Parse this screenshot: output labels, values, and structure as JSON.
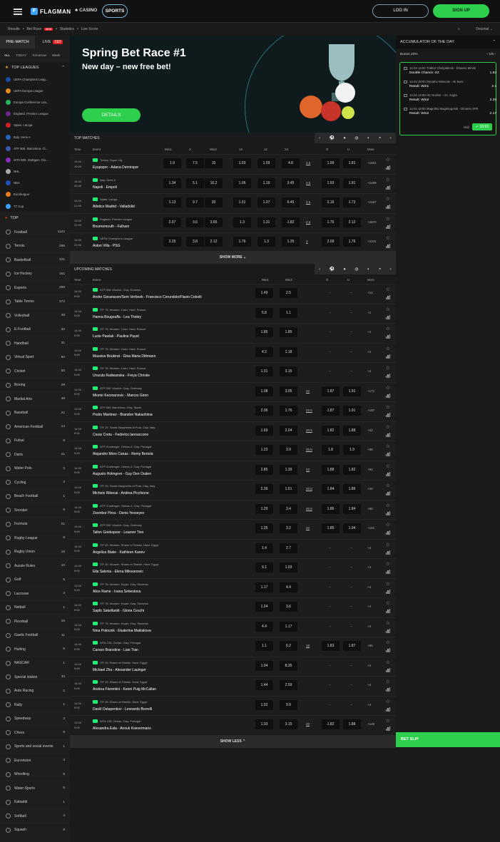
{
  "header": {
    "logo": "FLAGMAN",
    "casino": "CASINO",
    "sports": "SPORTS",
    "login": "LOG IN",
    "signup": "SIGN UP"
  },
  "breadcrumbs": [
    "Results",
    "Bet Race",
    "Statistics",
    "Live Score"
  ],
  "breadcrumb_new": "NEW",
  "odds_format": "Decimal",
  "sidebar": {
    "tab_prematch": "PRE-MATCH",
    "tab_live": "LIVE",
    "live_count": "192",
    "filters": [
      "ALL",
      "TODAY",
      "Tomorrow",
      "Week"
    ],
    "top_leagues_label": "TOP LEAGUES",
    "leagues": [
      "UEFA Champions Leag...",
      "UEFA Europa League",
      "Europa Conference Lea...",
      "England. Premier League",
      "Spain. LaLiga",
      "Italy. Serie A",
      "ATP 500. Barcelona. Cl...",
      "WTA 500. Stuttgart. Cla...",
      "NHL",
      "NBA",
      "Euroleague",
      "T7 Cup"
    ],
    "top_label": "TOP",
    "sports": [
      [
        "Football",
        "1122"
      ],
      [
        "Tennis",
        "296"
      ],
      [
        "Basketball",
        "101"
      ],
      [
        "Ice Hockey",
        "151"
      ],
      [
        "Esports",
        "269"
      ],
      [
        "Table Tennis",
        "272"
      ],
      [
        "Volleyball",
        "48"
      ],
      [
        "E-Football",
        "32"
      ],
      [
        "Handball",
        "31"
      ],
      [
        "Virtual Sport",
        "90"
      ],
      [
        "Cricket",
        "55"
      ],
      [
        "Boxing",
        "29"
      ],
      [
        "Martial Arts",
        "49"
      ],
      [
        "Baseball",
        "21"
      ],
      [
        "American Football",
        "14"
      ],
      [
        "Futsal",
        "9"
      ],
      [
        "Darts",
        "21"
      ],
      [
        "Water Polo",
        "3"
      ],
      [
        "Cycling",
        "3"
      ],
      [
        "Beach Football",
        "1"
      ],
      [
        "Snooker",
        "9"
      ],
      [
        "Formula",
        "21"
      ],
      [
        "Rugby League",
        "9"
      ],
      [
        "Rugby Union",
        "16"
      ],
      [
        "Aussie Rules",
        "10"
      ],
      [
        "Golf",
        "5"
      ],
      [
        "Lacrosse",
        "3"
      ],
      [
        "Netball",
        "1"
      ],
      [
        "Floorball",
        "18"
      ],
      [
        "Gaelic Football",
        "11"
      ],
      [
        "Hurling",
        "6"
      ],
      [
        "NASCAR",
        "1"
      ],
      [
        "Special stakes",
        "33"
      ],
      [
        "Auto Racing",
        "2"
      ],
      [
        "Rally",
        "1"
      ],
      [
        "Speedway",
        "3"
      ],
      [
        "Chess",
        "9"
      ],
      [
        "Sports and social events",
        "1"
      ],
      [
        "Eurovision",
        "3"
      ],
      [
        "Wrestling",
        "9"
      ],
      [
        "Water Sports",
        "5"
      ],
      [
        "Kabaddi",
        "1"
      ],
      [
        "Softball",
        "4"
      ],
      [
        "Squash",
        "8"
      ]
    ]
  },
  "banner": {
    "title": "Spring Bet Race #1",
    "subtitle": "New day – new free bet!",
    "button": "DETAILS"
  },
  "top_matches": {
    "label": "TOP MATCHES",
    "cols": [
      "Time",
      "Event",
      "Win1",
      "X",
      "Win2",
      "1X",
      "12",
      "X2",
      "O",
      "U",
      "More"
    ],
    "rows": [
      {
        "d": "14.04",
        "t": "19:00",
        "lg": "Turkey. Super Lig",
        "teams": "Eyupspor  -  Adana Demirspor",
        "o": [
          "1.9",
          "7.5",
          "15",
          "1.03",
          "1.09",
          "4.8",
          "2.5",
          "1.99",
          "1.81"
        ],
        "more": "+1801"
      },
      {
        "d": "14.04",
        "t": "20:45",
        "lg": "Italy. Serie A",
        "teams": "Napoli  -  Empoli",
        "o": [
          "1.34",
          "5.1",
          "10.2",
          "1.06",
          "1.19",
          "3.45",
          "2.5",
          "1.93",
          "1.91"
        ],
        "more": "+2489"
      },
      {
        "d": "14.04",
        "t": "21:00",
        "lg": "Spain. LaLiga",
        "teams": "Atletico Madrid  -  Valladolid",
        "o": [
          "1.13",
          "9.7",
          "20",
          "1.01",
          "1.07",
          "6.45",
          "2.5",
          "2.16",
          "1.73"
        ],
        "more": "+2467"
      },
      {
        "d": "14.04",
        "t": "21:00",
        "lg": "England. Premier League",
        "teams": "Bournemouth  -  Fulham",
        "o": [
          "2.07",
          "3.6",
          "3.65",
          "1.3",
          "1.31",
          "1.82",
          "2.5",
          "1.76",
          "2.12"
        ],
        "more": "+2670"
      },
      {
        "d": "14.04",
        "t": "21:00",
        "lg": "UEFA Champions League",
        "teams": "Aston Villa  -  PSG",
        "o": [
          "3.35",
          "3.8",
          "2.12",
          "1.76",
          "1.3",
          "1.35",
          "3",
          "2.09",
          "1.76"
        ],
        "more": "+2341"
      }
    ],
    "show_more": "SHOW MORE"
  },
  "upcoming": {
    "label": "UPCOMING MATCHES",
    "cols": [
      "Time",
      "Event",
      "Win1",
      "Win2",
      "O",
      "U",
      "More"
    ],
    "rows": [
      {
        "d": "14.04",
        "t": "9:00",
        "lg": "ATP 500. Munich. Clay. Doubles",
        "teams": "Andre Goransson/Sem Verbeek  -  Francisco Cerundolo/Flavio Cobolli",
        "o": [
          "1.49",
          "2.5",
          "",
          "",
          ""
        ],
        "more": "+12"
      },
      {
        "d": "14.04",
        "t": "9:00",
        "lg": "ITF 75. Women. Calvi. Hard. France",
        "teams": "Hanna Bougouffa  -  Lea Tholey",
        "o": [
          "5.8",
          "1.1",
          "",
          "",
          ""
        ],
        "more": "+2"
      },
      {
        "d": "14.04",
        "t": "9:00",
        "lg": "ITF 75. Women. Calvi. Hard. France",
        "teams": "Lucie Pawlak  -  Pauline Payet",
        "o": [
          "1.85",
          "1.85",
          "",
          "",
          ""
        ],
        "more": "+4"
      },
      {
        "d": "14.04",
        "t": "9:00",
        "lg": "ITF 75. Women. Calvi. Hard. France",
        "teams": "Massiva Boukirat  -  Gina Maria Dittmann",
        "o": [
          "4.2",
          "1.18",
          "",
          "",
          ""
        ],
        "more": "+4"
      },
      {
        "d": "14.04",
        "t": "9:00",
        "lg": "ITF 75. Women. Calvi. Hard. France",
        "teams": "Urszula Radwanska  -  Freya Christie",
        "o": [
          "1.31",
          "3.15",
          "",
          "",
          ""
        ],
        "more": "+4"
      },
      {
        "d": "14.04",
        "t": "9:00",
        "lg": "ATP 500. Munich. Clay. Germany",
        "teams": "Miomir Kecmanovic  -  Marcos Giron",
        "o": [
          "1.38",
          "3.05",
          "22",
          "1.87",
          "1.91"
        ],
        "more": "+171"
      },
      {
        "d": "14.04",
        "t": "9:00",
        "lg": "ATP 500. Barcelona. Clay. Spain",
        "teams": "Pedro Martinez  -  Brandon Nakashima",
        "o": [
          "2.06",
          "1.76",
          "22.5",
          "1.87",
          "1.91"
        ],
        "more": "+187"
      },
      {
        "d": "14.04",
        "t": "9:00",
        "lg": "ITF 25. Santa Margherita di Pula. Clay. Italy",
        "teams": "Cezar Cretu  -  Federico Iannaccone",
        "o": [
          "1.69",
          "2.04",
          "20.5",
          "1.82",
          "1.88"
        ],
        "more": "+32"
      },
      {
        "d": "14.04",
        "t": "9:00",
        "lg": "ATP Challenger. Oeiras-4. Clay. Portugal",
        "teams": "Alejandro Moro Canas  -  Remy Bertola",
        "o": [
          "1.23",
          "3.9",
          "20.5",
          "1.8",
          "1.9"
        ],
        "more": "+88"
      },
      {
        "d": "14.04",
        "t": "9:00",
        "lg": "ATP Challenger. Oeiras-4. Clay. Portugal",
        "teams": "Augusto Holmgren  -  Guy Den Ouden",
        "o": [
          "2.85",
          "1.39",
          "22",
          "1.88",
          "1.82"
        ],
        "more": "+92"
      },
      {
        "d": "14.04",
        "t": "9:00",
        "lg": "ITF 25. Santa Margherita di Pula. Clay. Italy",
        "teams": "Michele Ribecai  -  Andrea Picchione",
        "o": [
          "2.39",
          "1.51",
          "20.5",
          "1.84",
          "1.86"
        ],
        "more": "+40"
      },
      {
        "d": "14.04",
        "t": "9:00",
        "lg": "ATP Challenger. Oeiras-4. Clay. Portugal",
        "teams": "Zsombor Piros  -  Denis Yevseyev",
        "o": [
          "1.29",
          "3.4",
          "20.5",
          "1.86",
          "1.84"
        ],
        "more": "+90"
      },
      {
        "d": "14.04",
        "t": "9:00",
        "lg": "ATP 500. Munich. Clay. Germany",
        "teams": "Tallon Griekspoor  -  Learner Tien",
        "o": [
          "1.35",
          "3.2",
          "22",
          "1.85",
          "1.94"
        ],
        "more": "+191"
      },
      {
        "d": "14.04",
        "t": "9:00",
        "lg": "ITF 30. Women. Sharm el Sheikh. Hard. Egypt",
        "teams": "Angelica Blake  -  Kathleen Kanev",
        "o": [
          "1.4",
          "2.7",
          "",
          "",
          ""
        ],
        "more": "+4"
      },
      {
        "d": "14.04",
        "t": "9:00",
        "lg": "ITF 30. Women. Sharm el Sheikh. Hard. Egypt",
        "teams": "Ella Salvnia  -  Elena Milovanovic",
        "o": [
          "9.1",
          "1.03",
          "",
          "",
          ""
        ],
        "more": "+4"
      },
      {
        "d": "14.04",
        "t": "9:00",
        "lg": "ITF 75. Women. Koper. Clay. Slovenia",
        "teams": "Alice Rame  -  Ivana Sebestova",
        "o": [
          "1.17",
          "4.4",
          "",
          "",
          ""
        ],
        "more": "+4"
      },
      {
        "d": "14.04",
        "t": "9:00",
        "lg": "ITF 75. Women. Koper. Clay. Slovenia",
        "teams": "Sapfo Sakellaridi  -  Gloria Ceschi",
        "o": [
          "1.24",
          "3.6",
          "",
          "",
          ""
        ],
        "more": "+4"
      },
      {
        "d": "14.04",
        "t": "9:00",
        "lg": "ITF 75. Women. Koper. Clay. Slovenia",
        "teams": "Nina Potocnik  -  Ekaterina Maklakova",
        "o": [
          "4.4",
          "1.17",
          "",
          "",
          ""
        ],
        "more": "+4"
      },
      {
        "d": "14.04",
        "t": "9:00",
        "lg": "WTA 125. Oeiras. Clay. Portugal",
        "teams": "Carson Branstine  -  Lian Tran",
        "o": [
          "1.1",
          "6.2",
          "18",
          "1.83",
          "1.87"
        ],
        "more": "+95"
      },
      {
        "d": "14.04",
        "t": "9:00",
        "lg": "ITF 25. Sharm el Sheikh. Hard. Egypt",
        "teams": "Michael Zhu  -  Alexander Lauinger",
        "o": [
          "1.04",
          "8.35",
          "",
          "",
          ""
        ],
        "more": "+4"
      },
      {
        "d": "14.04",
        "t": "9:00",
        "lg": "ITF 25. Sharm el Sheikh. Hard. Egypt",
        "teams": "Andrea Fiorentini  -  Keoni Puig McCallan",
        "o": [
          "1.44",
          "2.59",
          "",
          "",
          ""
        ],
        "more": "+4"
      },
      {
        "d": "14.04",
        "t": "9:00",
        "lg": "ITF 25. Sharm el Sheikh. Hard. Egypt",
        "teams": "Daniil Ostapenkov  -  Leonardo Borrelli",
        "o": [
          "1.02",
          "9.9",
          "",
          "",
          ""
        ],
        "more": "+4"
      },
      {
        "d": "14.04",
        "t": "9:00",
        "lg": "WTA 125. Oeiras. Clay. Portugal",
        "teams": "Alexandra Eala  -  Anouk Koevermans",
        "o": [
          "1.33",
          "3.15",
          "20",
          "1.82",
          "1.88"
        ],
        "more": "+108"
      }
    ],
    "show_less": "SHOW LESS"
  },
  "accumulator": {
    "title": "ACCUMULATOR OF THE DAY",
    "bonus": "Bonus 20%",
    "page": "1/6",
    "items": [
      {
        "l1": "14.04 14:00  Traktor Chelyabinsk - Dinamo Minsk",
        "bet": "Double Chance: X2",
        "odd": "1.62"
      },
      {
        "l1": "14.04 18:00  Dynamo Moscow - Ak Bars",
        "bet": "Result: Win1",
        "odd": "2.1"
      },
      {
        "l1": "14.04 14:00  HC Norilsk - HC Yugra",
        "bet": "Result: Win2",
        "odd": "2.25"
      },
      {
        "l1": "14.04 16:00  Magnitka Magnitogorsk - Dinamo SPb",
        "bet": "Result: Win2",
        "odd": "2.17"
      }
    ],
    "total_label": "Odd",
    "total": "19.93"
  },
  "betslip": "BET SLIP"
}
